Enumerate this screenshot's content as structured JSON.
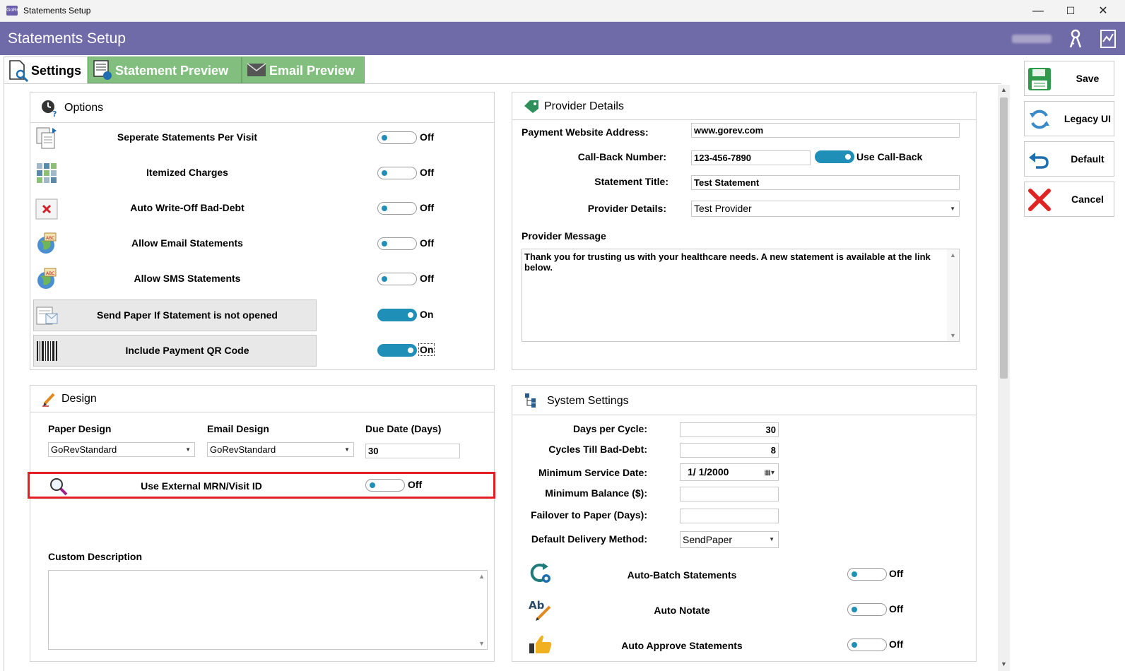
{
  "window": {
    "title": "Statements Setup",
    "app_icon_text": "GoRev",
    "minimize": "—",
    "maximize": "☐",
    "close": "✕"
  },
  "header": {
    "title": "Statements Setup"
  },
  "tabs": [
    {
      "label": "Settings",
      "active": true
    },
    {
      "label": "Statement Preview",
      "active": false
    },
    {
      "label": "Email Preview",
      "active": false
    }
  ],
  "options": {
    "title": "Options",
    "items": [
      {
        "label": "Seperate Statements Per Visit",
        "state": "Off"
      },
      {
        "label": "Itemized Charges",
        "state": "Off"
      },
      {
        "label": "Auto Write-Off Bad-Debt",
        "state": "Off"
      },
      {
        "label": "Allow Email Statements",
        "state": "Off"
      },
      {
        "label": "Allow SMS Statements",
        "state": "Off"
      },
      {
        "label": "Send Paper If Statement is not opened",
        "state": "On"
      },
      {
        "label": "Include Payment QR Code",
        "state": "On"
      }
    ]
  },
  "design": {
    "title": "Design",
    "paper_design_label": "Paper Design",
    "paper_design_value": "GoRevStandard",
    "email_design_label": "Email Design",
    "email_design_value": "GoRevStandard",
    "due_date_label": "Due Date (Days)",
    "due_date_value": "30",
    "external_id_label": "Use External MRN/Visit ID",
    "external_id_state": "Off",
    "custom_description_label": "Custom Description",
    "custom_description_value": ""
  },
  "provider": {
    "title": "Provider Details",
    "website_label": "Payment Website Address:",
    "website_value": "www.gorev.com",
    "callback_label": "Call-Back Number:",
    "callback_value": "123-456-7890",
    "use_callback_label": "Use Call-Back",
    "statement_title_label": "Statement Title:",
    "statement_title_value": "Test Statement",
    "provider_details_label": "Provider Details:",
    "provider_details_value": "Test Provider",
    "message_label": "Provider Message",
    "message_value": "Thank you for trusting us with your healthcare needs.  A new statement is available at the link below."
  },
  "system": {
    "title": "System Settings",
    "days_per_cycle_label": "Days per Cycle:",
    "days_per_cycle_value": "30",
    "cycles_bad_debt_label": "Cycles Till Bad-Debt:",
    "cycles_bad_debt_value": "8",
    "min_service_date_label": "Minimum Service Date:",
    "min_service_date_value": "1/  1/2000",
    "min_balance_label": "Minimum Balance ($):",
    "min_balance_value": "",
    "failover_label": "Failover to Paper (Days):",
    "failover_value": "",
    "delivery_label": "Default Delivery Method:",
    "delivery_value": "SendPaper",
    "toggles": [
      {
        "label": "Auto-Batch Statements",
        "state": "Off"
      },
      {
        "label": "Auto Notate",
        "state": "Off"
      },
      {
        "label": "Auto Approve Statements",
        "state": "Off"
      }
    ]
  },
  "actions": {
    "save": "Save",
    "legacy": "Legacy UI",
    "default": "Default",
    "cancel": "Cancel"
  }
}
